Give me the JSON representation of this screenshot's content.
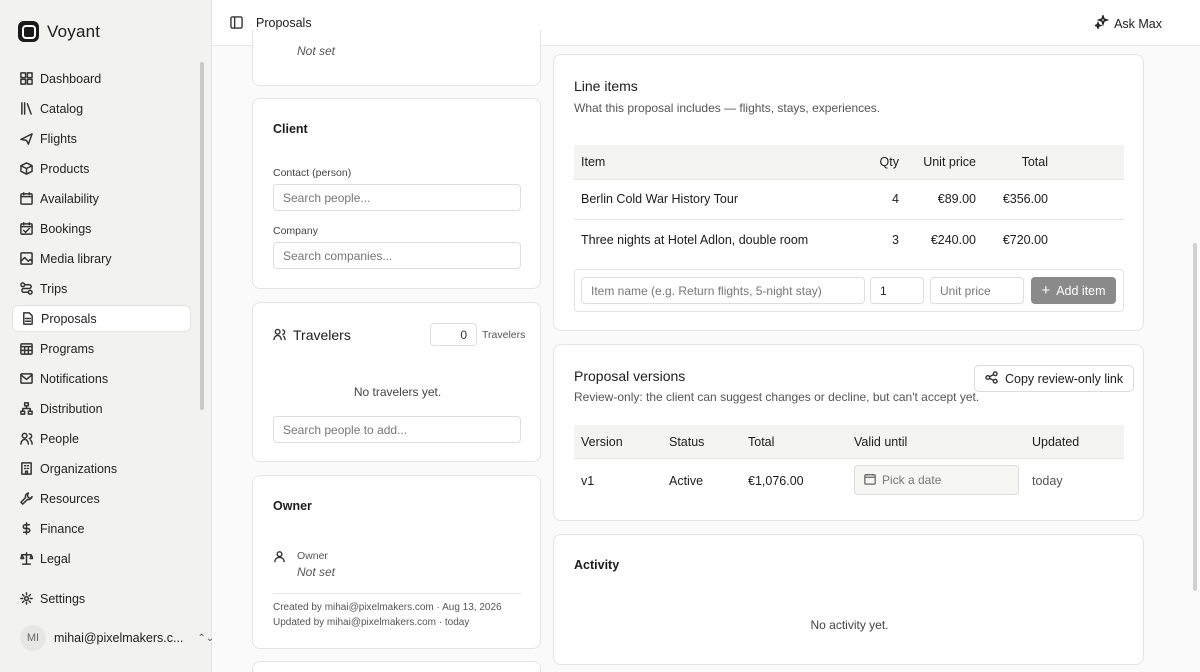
{
  "brand": {
    "name": "Voyant"
  },
  "nav": [
    {
      "label": "Dashboard",
      "icon": "dashboard-icon"
    },
    {
      "label": "Catalog",
      "icon": "catalog-icon"
    },
    {
      "label": "Flights",
      "icon": "plane-icon"
    },
    {
      "label": "Products",
      "icon": "box-icon"
    },
    {
      "label": "Availability",
      "icon": "calendar-icon"
    },
    {
      "label": "Bookings",
      "icon": "calendar-check-icon"
    },
    {
      "label": "Media library",
      "icon": "image-icon"
    },
    {
      "label": "Trips",
      "icon": "route-icon"
    },
    {
      "label": "Proposals",
      "icon": "document-icon",
      "active": true
    },
    {
      "label": "Programs",
      "icon": "calendar-grid-icon"
    },
    {
      "label": "Notifications",
      "icon": "mail-icon"
    },
    {
      "label": "Distribution",
      "icon": "network-icon"
    },
    {
      "label": "People",
      "icon": "people-icon"
    },
    {
      "label": "Organizations",
      "icon": "building-icon"
    },
    {
      "label": "Resources",
      "icon": "wrench-icon"
    },
    {
      "label": "Finance",
      "icon": "dollar-icon"
    },
    {
      "label": "Legal",
      "icon": "scale-icon"
    }
  ],
  "settings": {
    "label": "Settings"
  },
  "user": {
    "initials": "MI",
    "email": "mihai@pixelmakers.c..."
  },
  "header": {
    "breadcrumb": "Proposals",
    "ask": "Ask Max"
  },
  "top_card": {
    "value": "Not set"
  },
  "client": {
    "title": "Client",
    "contact_label": "Contact (person)",
    "contact_placeholder": "Search people...",
    "company_label": "Company",
    "company_placeholder": "Search companies..."
  },
  "travelers": {
    "title": "Travelers",
    "count": "0",
    "count_label": "Travelers",
    "empty": "No travelers yet.",
    "placeholder": "Search people to add..."
  },
  "owner": {
    "title": "Owner",
    "label": "Owner",
    "value": "Not set",
    "created": "Created by mihai@pixelmakers.com · Aug 13, 2026",
    "updated": "Updated by mihai@pixelmakers.com · today"
  },
  "line_items": {
    "title": "Line items",
    "subtitle": "What this proposal includes — flights, stays, experiences.",
    "columns": [
      "Item",
      "Qty",
      "Unit price",
      "Total"
    ],
    "rows": [
      {
        "item": "Berlin Cold War History Tour",
        "qty": "4",
        "unit": "€89.00",
        "total": "€356.00"
      },
      {
        "item": "Three nights at Hotel Adlon, double room",
        "qty": "3",
        "unit": "€240.00",
        "total": "€720.00"
      }
    ],
    "name_placeholder": "Item name (e.g. Return flights, 5-night stay)",
    "qty_value": "1",
    "price_placeholder": "Unit price",
    "add_label": "Add item"
  },
  "versions": {
    "title": "Proposal versions",
    "subtitle": "Review-only: the client can suggest changes or decline, but can't accept yet.",
    "copy_label": "Copy review-only link",
    "columns": [
      "Version",
      "Status",
      "Total",
      "Valid until",
      "Updated"
    ],
    "row": {
      "version": "v1",
      "status": "Active",
      "total": "€1,076.00",
      "date_placeholder": "Pick a date",
      "updated": "today"
    }
  },
  "activity": {
    "title": "Activity",
    "empty": "No activity yet."
  }
}
